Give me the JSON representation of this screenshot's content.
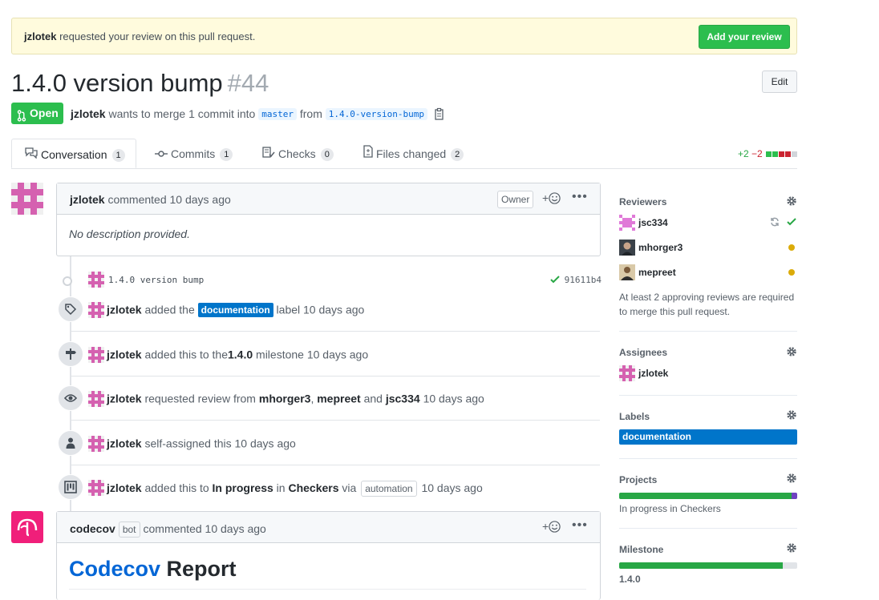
{
  "banner": {
    "user": "jzlotek",
    "message": "requested your review on this pull request.",
    "button": "Add your review"
  },
  "pr": {
    "title": "1.4.0 version bump",
    "number": "#44",
    "edit_label": "Edit",
    "state": "Open",
    "author": "jzlotek",
    "merge_text": "wants to merge 1 commit into",
    "base_branch": "master",
    "from_text": "from",
    "head_branch": "1.4.0-version-bump"
  },
  "tabs": [
    {
      "label": "Conversation",
      "count": "1"
    },
    {
      "label": "Commits",
      "count": "1"
    },
    {
      "label": "Checks",
      "count": "0"
    },
    {
      "label": "Files changed",
      "count": "2"
    }
  ],
  "diffstat": {
    "additions": "+2",
    "deletions": "−2"
  },
  "comment1": {
    "author": "jzlotek",
    "action": "commented 10 days ago",
    "owner_label": "Owner",
    "body": "No description provided."
  },
  "commit": {
    "message": "1.4.0 version bump",
    "sha": "91611b4"
  },
  "events": {
    "label": {
      "user": "jzlotek",
      "pre": "added the",
      "label": "documentation",
      "post": "label 10 days ago"
    },
    "milestone": {
      "user": "jzlotek",
      "pre": "added this to the",
      "milestone": "1.4.0",
      "post": "milestone 10 days ago"
    },
    "review": {
      "user": "jzlotek",
      "pre": "requested review from",
      "r1": "mhorger3",
      "comma": ",",
      "r2": "mepreet",
      "and": "and",
      "r3": "jsc334",
      "post": "10 days ago"
    },
    "assign": {
      "user": "jzlotek",
      "text": "self-assigned this 10 days ago"
    },
    "project": {
      "user": "jzlotek",
      "pre": "added this to",
      "column": "In progress",
      "in": "in",
      "project": "Checkers",
      "via": "via",
      "automation": "automation",
      "post": "10 days ago"
    }
  },
  "comment2": {
    "author": "codecov",
    "bot_label": "bot",
    "action": "commented 10 days ago",
    "report_link": "Codecov",
    "report_word": "Report"
  },
  "sidebar": {
    "reviewers_title": "Reviewers",
    "reviewers": [
      "jsc334",
      "mhorger3",
      "mepreet"
    ],
    "review_note": "At least 2 approving reviews are required to merge this pull request.",
    "assignees_title": "Assignees",
    "assignee": "jzlotek",
    "labels_title": "Labels",
    "label": "documentation",
    "projects_title": "Projects",
    "project_text": "In progress in Checkers",
    "project_progress": 0.97,
    "milestone_title": "Milestone",
    "milestone": "1.4.0",
    "milestone_progress": 0.92
  },
  "colors": {
    "green": "#2cbe4e",
    "label_blue": "#0075ca",
    "pending": "#dbab09",
    "codecov": "#f01f7a"
  }
}
